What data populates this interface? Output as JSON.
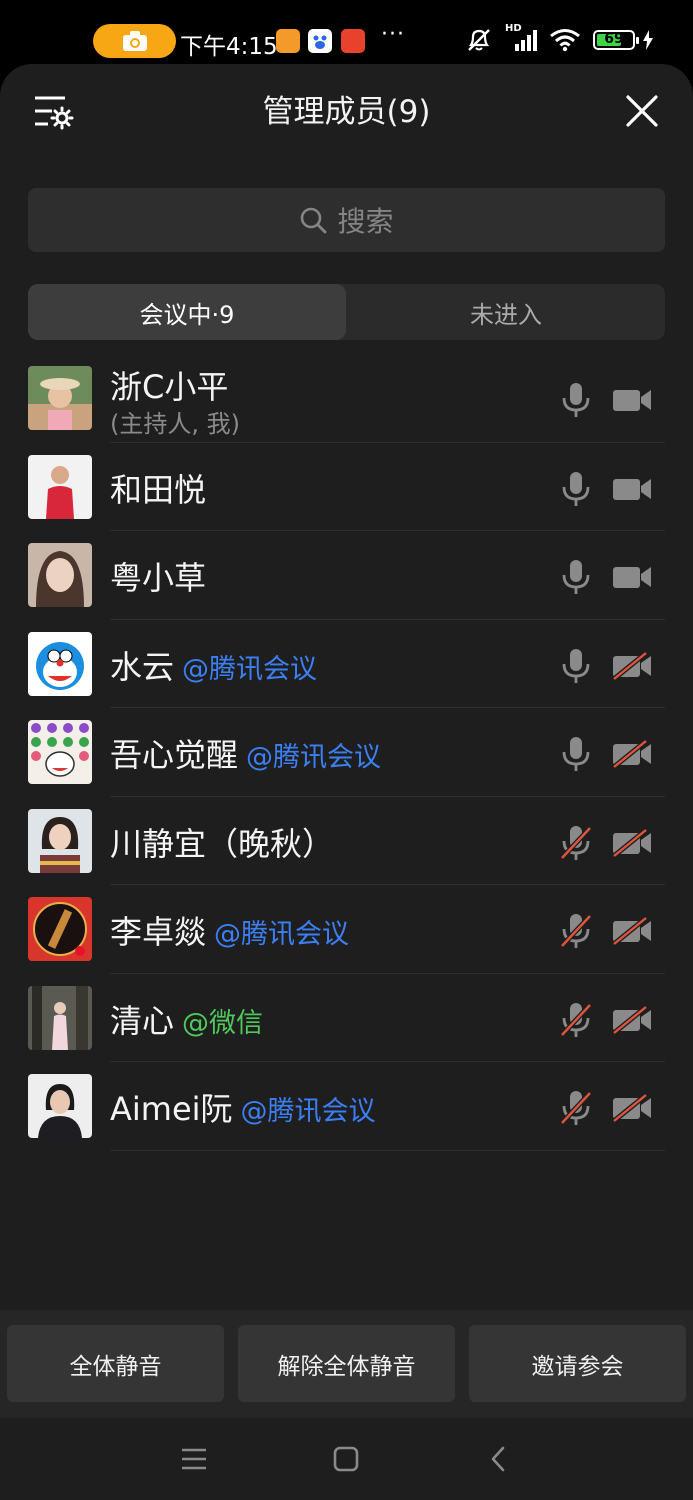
{
  "status_bar": {
    "time": "下午4:15",
    "battery": "69",
    "network_label": "HD",
    "more": "···"
  },
  "header": {
    "title": "管理成员(9)"
  },
  "search": {
    "placeholder": "搜索"
  },
  "tabs": [
    {
      "label": "会议中·9",
      "active": true
    },
    {
      "label": "未进入",
      "active": false
    }
  ],
  "members": [
    {
      "name": "浙C小平",
      "sub": "(主持人, 我)",
      "source": "",
      "mic": "on",
      "camera": "on"
    },
    {
      "name": "和田悦",
      "sub": "",
      "source": "",
      "mic": "on",
      "camera": "on"
    },
    {
      "name": "粤小草",
      "sub": "",
      "source": "",
      "mic": "on",
      "camera": "on"
    },
    {
      "name": "水云",
      "sub": "",
      "source": "@腾讯会议",
      "mic": "on",
      "camera": "off"
    },
    {
      "name": "吾心觉醒",
      "sub": "",
      "source": "@腾讯会议",
      "mic": "on",
      "camera": "off"
    },
    {
      "name": "川静宜（晚秋）",
      "sub": "",
      "source": "",
      "mic": "off",
      "camera": "off"
    },
    {
      "name": "李卓燚",
      "sub": "",
      "source": "@腾讯会议",
      "mic": "off",
      "camera": "off"
    },
    {
      "name": "清心",
      "sub": "",
      "source": "@微信",
      "mic": "off",
      "camera": "off"
    },
    {
      "name": "Aimei阮",
      "sub": "",
      "source": "@腾讯会议",
      "mic": "off",
      "camera": "off"
    }
  ],
  "actions": {
    "mute_all": "全体静音",
    "unmute_all": "解除全体静音",
    "invite": "邀请参会"
  },
  "colors": {
    "sheet_bg": "#1e1e1e",
    "tencent_source": "#3b7ff5",
    "wechat_source": "#4fc85b",
    "muted_red": "#e0533d",
    "icon_gray": "#8a8a8a"
  }
}
